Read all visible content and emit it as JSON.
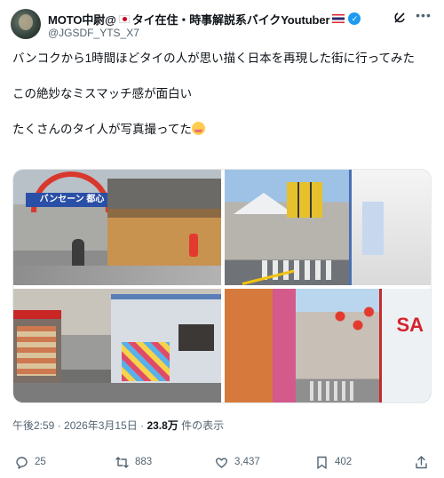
{
  "author": {
    "display_name": "MOTO中尉@",
    "display_name_suffix": "タイ在住・時事解説系バイクYoutuber",
    "handle": "@JGSDF_YTS_X7"
  },
  "post": {
    "lines": [
      "バンコクから1時間ほどタイの人が思い描く日本を再現した街に行ってみた",
      "この絶妙なミスマッチ感が面白い",
      "たくさんのタイ人が写真撮ってた"
    ],
    "photo1_sign": "バンセーン 都心",
    "photo4_sign": "SA"
  },
  "meta": {
    "time": "午後2:59",
    "separator": "·",
    "date": "2026年3月15日",
    "views_count": "23.8万",
    "views_label": "件の表示"
  },
  "actions": {
    "replies": "25",
    "retweets": "883",
    "likes": "3,437",
    "bookmarks": "402"
  },
  "icons": {
    "verified": "verified-badge-icon",
    "grok": "grok-icon",
    "more": "more-icon",
    "reply": "reply-icon",
    "retweet": "retweet-icon",
    "like": "heart-icon",
    "bookmark": "bookmark-icon",
    "share": "share-icon"
  },
  "colors": {
    "accent": "#1d9bf0",
    "text": "#0f1419",
    "secondary": "#536471"
  }
}
